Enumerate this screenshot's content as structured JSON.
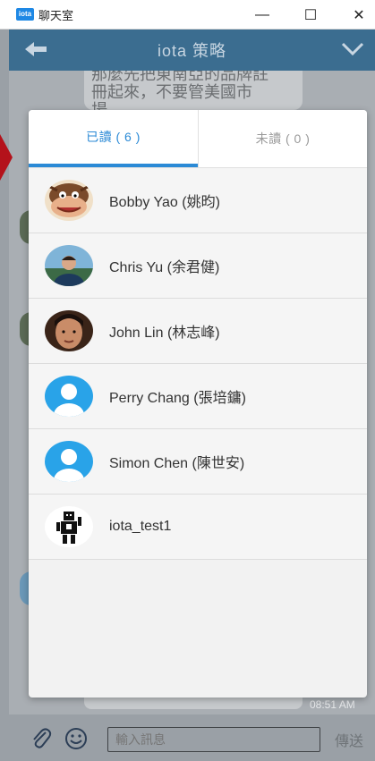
{
  "window": {
    "title": "聊天室",
    "badge": "iota",
    "min_symbol": "—",
    "max_symbol": "☐",
    "close_symbol": "✕"
  },
  "header": {
    "title": "iota 策略",
    "back_icon": "arrow-left-icon",
    "menu_icon": "chevron-down-icon"
  },
  "chat": {
    "bubble_text_line1": "那麼先把東南亞的品牌註",
    "bubble_text_line2": "冊起來，不要管美國市",
    "bubble_text_line3": "場。",
    "last_time": "08:51 AM"
  },
  "modal": {
    "tabs": [
      {
        "label": "已讀 ( 6 )",
        "active": true
      },
      {
        "label": "未讀 ( 0 )",
        "active": false
      }
    ],
    "users": [
      {
        "name": "Bobby Yao (姚昀)",
        "avatar": "tasmanian-devil-avatar"
      },
      {
        "name": "Chris Yu (余君健)",
        "avatar": "photo-avatar"
      },
      {
        "name": "John Lin (林志峰)",
        "avatar": "photo-avatar"
      },
      {
        "name": "Perry Chang (張培鏞)",
        "avatar": "default-person-avatar"
      },
      {
        "name": "Simon Chen (陳世安)",
        "avatar": "default-person-avatar"
      },
      {
        "name": "iota_test1",
        "avatar": "robot-avatar"
      }
    ]
  },
  "input": {
    "placeholder": "輸入訊息",
    "send_label": "傳送",
    "attach_icon": "paperclip-icon",
    "emoji_icon": "smiley-icon"
  },
  "colors": {
    "accent": "#2b8ad6",
    "header": "#3b6d90",
    "default_avatar": "#29a3e8",
    "red_arrow": "#b4121b"
  }
}
